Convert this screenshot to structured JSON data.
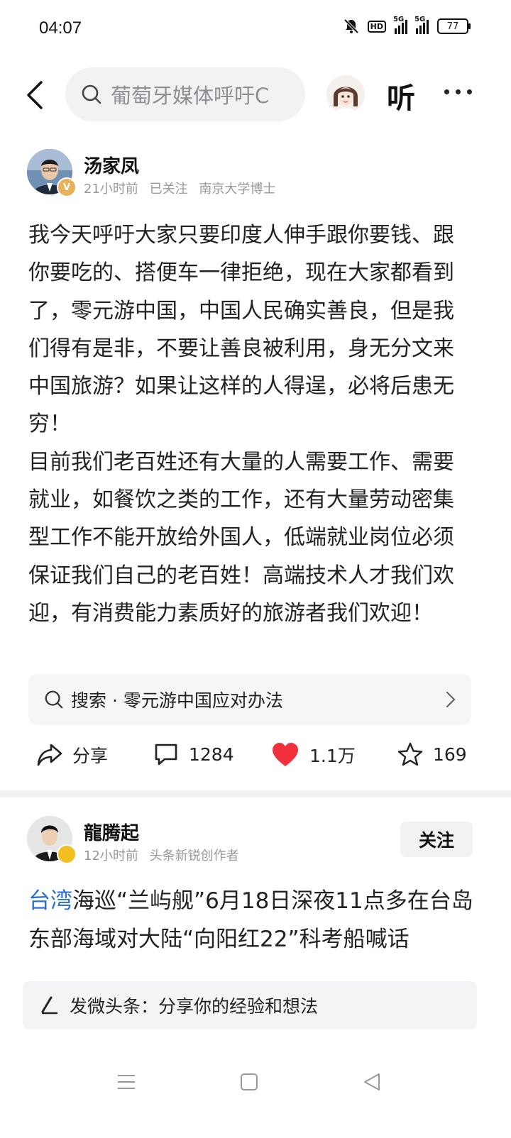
{
  "status_bar": {
    "time": "04:07",
    "hd_label": "HD",
    "sim1_label": "5G",
    "sim2_label": "5G",
    "battery": "77"
  },
  "topbar": {
    "search_text": "葡萄牙媒体呼吁C",
    "listen_label": "听"
  },
  "post": {
    "author_name": "汤家凤",
    "verified_badge": "V",
    "time_ago": "21小时前",
    "follow_status": "已关注",
    "author_title": "南京大学博士",
    "paragraphs": [
      "我今天呼吁大家只要印度人伸手跟你要钱、跟你要吃的、搭便车一律拒绝，现在大家都看到了，零元游中国，中国人民确实善良，但是我们得有是非，不要让善良被利用，身无分文来中国旅游？如果让这样的人得逞，必将后患无穷！",
      "目前我们老百姓还有大量的人需要工作、需要就业，如餐饮之类的工作，还有大量劳动密集型工作不能开放给外国人，低端就业岗位必须保证我们自己的老百姓！高端技术人才我们欢迎，有消费能力素质好的旅游者我们欢迎！"
    ],
    "search_suggestion": "搜索 · 零元游中国应对办法",
    "actions": {
      "share_label": "分享",
      "comment_count": "1284",
      "like_count": "1.1万",
      "favorite_count": "169"
    }
  },
  "post2": {
    "author_name": "龍腾起",
    "time_ago": "12小时前",
    "author_title": "头条新锐创作者",
    "follow_label": "关注",
    "link_text": "台湾",
    "text": "海巡“兰屿舰”6月18日深夜11点多在台岛东部海域对大陆“向阳红22”科考船喊话"
  },
  "compose": {
    "placeholder": "发微头条：分享你的经验和想法"
  },
  "colors": {
    "link": "#2a6fd6",
    "like_heart": "#f0313c",
    "badge_v": "#e8b15a"
  }
}
